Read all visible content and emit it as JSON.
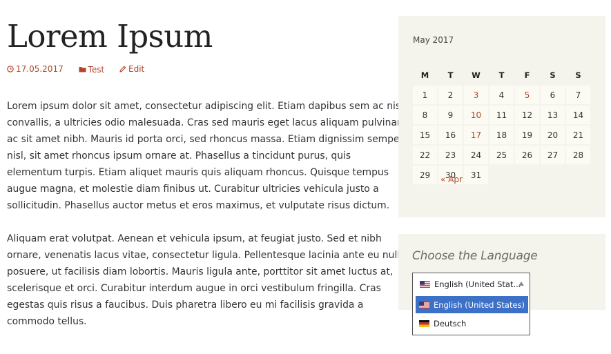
{
  "post": {
    "title": "Lorem Ipsum",
    "meta": {
      "date": "17.05.2017",
      "category": "Test",
      "edit": "Edit"
    },
    "paragraphs": [
      [
        "Lorem ipsum dolor sit amet, consectetur adipiscing elit. Etiam dapibus sem ac nisl",
        "convallis, a ultricies odio malesuada. Cras sed mauris eget lacus aliquam pulvinar",
        "ac sit amet nibh. Mauris id porta orci, sed rhoncus massa. Etiam dignissim semper",
        "nisl, sit amet rhoncus ipsum ornare at. Phasellus a tincidunt purus, quis",
        "elementum turpis. Etiam aliquet mauris quis aliquam rhoncus. Quisque tempus",
        "augue magna, et molestie diam finibus ut. Curabitur ultricies vehicula justo a",
        "sollicitudin. Phasellus auctor metus et eros maximus, et vulputate risus dictum."
      ],
      [
        "Aliquam erat volutpat. Aenean et vehicula ipsum, at feugiat justo. Sed et nibh",
        "ornare, venenatis lacus vitae, consectetur ligula. Pellentesque lacinia ante eu nulla",
        "posuere, ut facilisis diam lobortis. Mauris ligula ante, porttitor sit amet luctus at,",
        "scelerisque et orci. Curabitur interdum augue in orci vestibulum fringilla. Cras",
        "egestas quis risus a faucibus. Duis pharetra libero eu mi facilisis gravida a",
        "commodo tellus."
      ]
    ]
  },
  "calendar": {
    "caption": "May 2017",
    "weekdays": [
      "M",
      "T",
      "W",
      "T",
      "F",
      "S",
      "S"
    ],
    "weeks": [
      [
        {
          "d": "1"
        },
        {
          "d": "2"
        },
        {
          "d": "3",
          "link": true
        },
        {
          "d": "4"
        },
        {
          "d": "5",
          "link": true
        },
        {
          "d": "6"
        },
        {
          "d": "7"
        }
      ],
      [
        {
          "d": "8"
        },
        {
          "d": "9"
        },
        {
          "d": "10",
          "link": true
        },
        {
          "d": "11"
        },
        {
          "d": "12"
        },
        {
          "d": "13"
        },
        {
          "d": "14"
        }
      ],
      [
        {
          "d": "15"
        },
        {
          "d": "16"
        },
        {
          "d": "17",
          "link": true
        },
        {
          "d": "18"
        },
        {
          "d": "19"
        },
        {
          "d": "20"
        },
        {
          "d": "21"
        }
      ],
      [
        {
          "d": "22"
        },
        {
          "d": "23"
        },
        {
          "d": "24"
        },
        {
          "d": "25"
        },
        {
          "d": "26"
        },
        {
          "d": "27"
        },
        {
          "d": "28"
        }
      ],
      [
        {
          "d": "29"
        },
        {
          "d": "30"
        },
        {
          "d": "31"
        },
        {
          "d": ""
        },
        {
          "d": ""
        },
        {
          "d": ""
        },
        {
          "d": ""
        }
      ]
    ],
    "prev_link": "« Apr"
  },
  "language_widget": {
    "title": "Choose the Language",
    "selected": "English (United Stat...",
    "options": [
      {
        "label": "English (United States)",
        "flag": "us-flag-icon",
        "highlighted": true
      },
      {
        "label": "Deutsch",
        "flag": "de-flag-icon",
        "highlighted": false
      }
    ]
  },
  "colors": {
    "accent": "#b0452a",
    "widget_bg": "#f5f4ec",
    "highlight": "#3d71c8"
  }
}
